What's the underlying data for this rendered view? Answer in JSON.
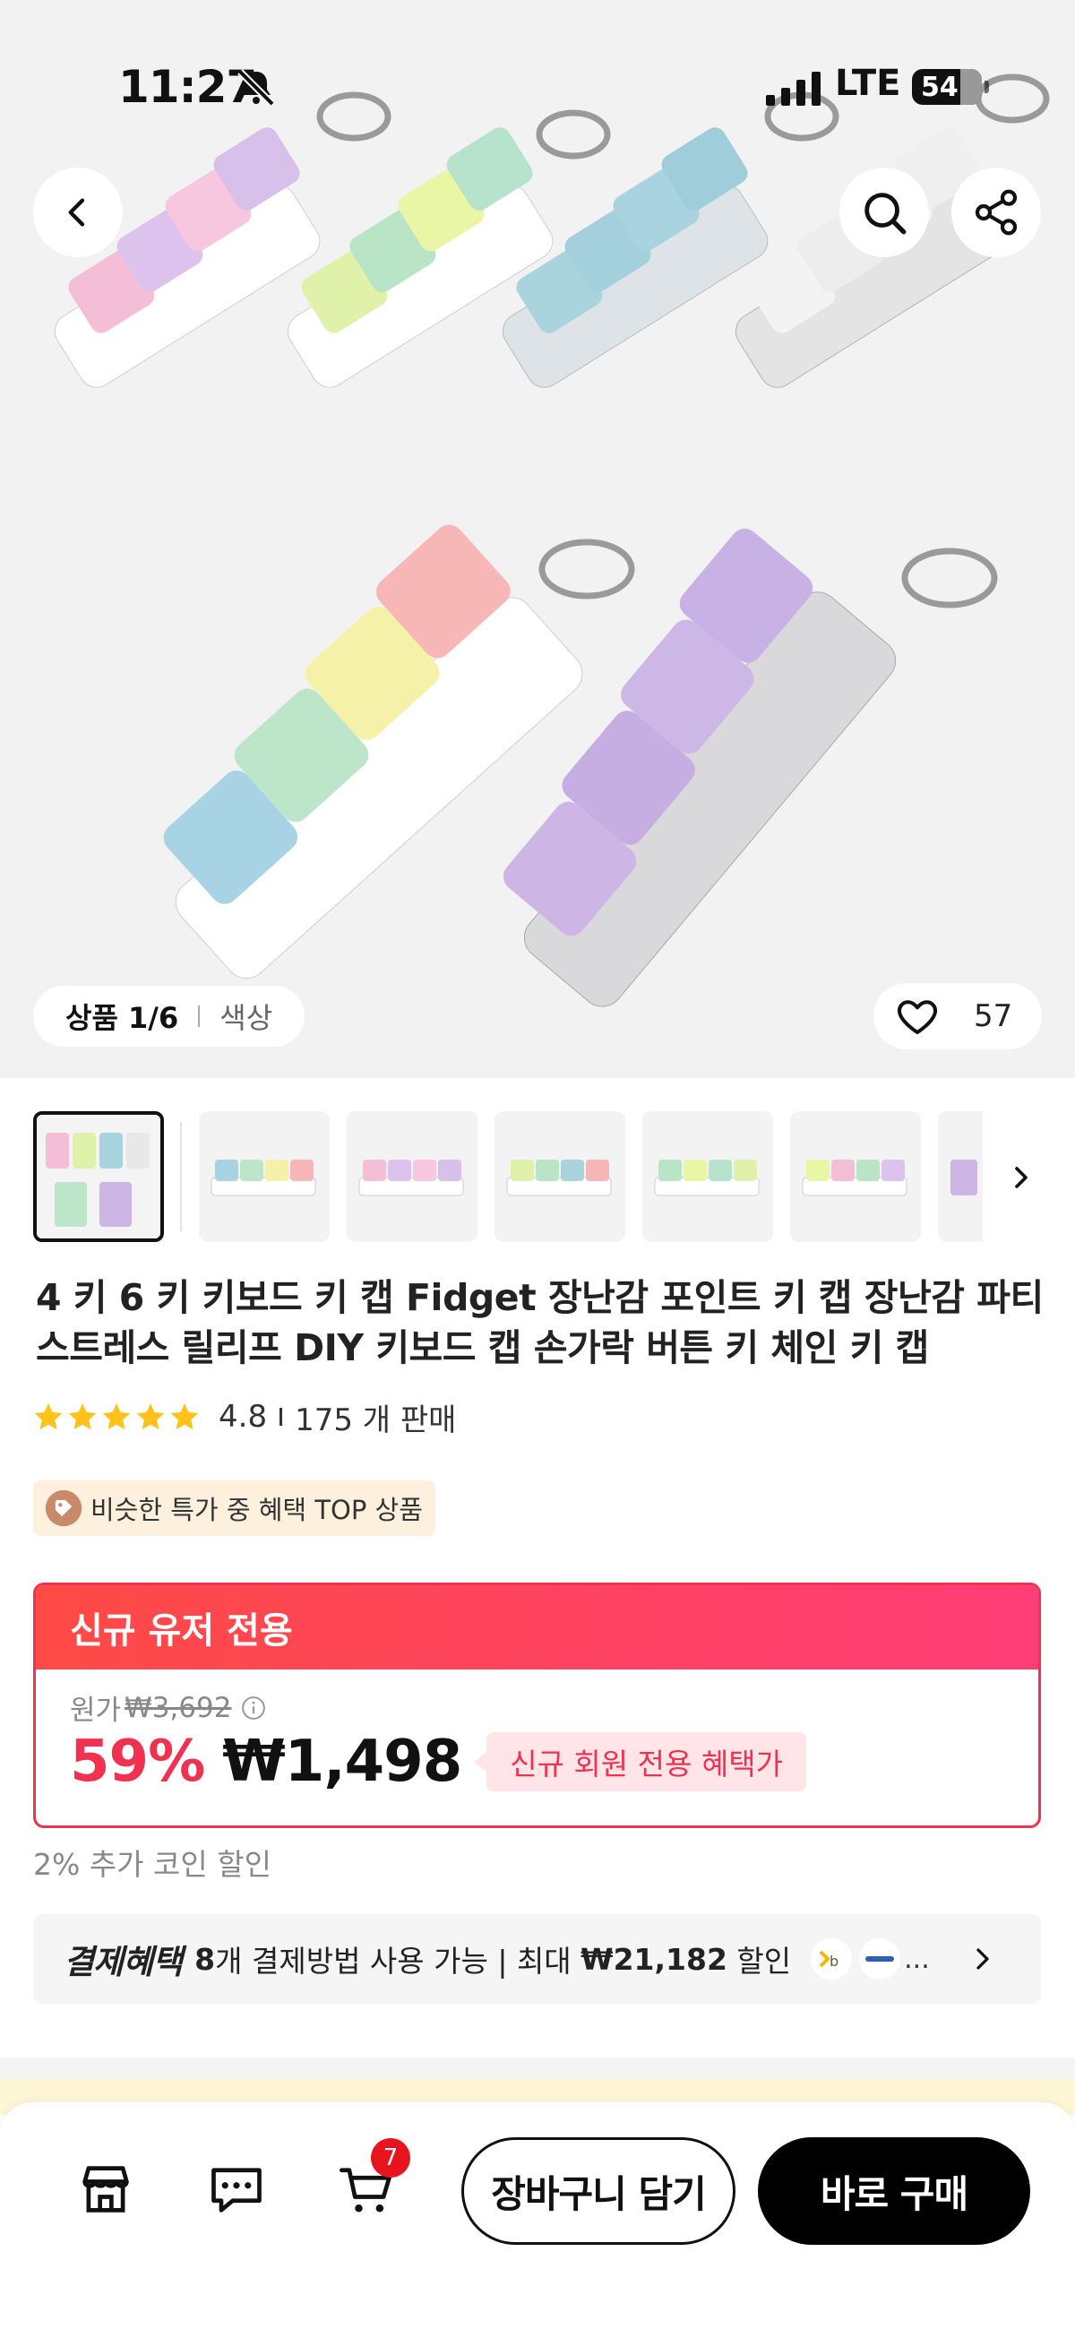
{
  "status_bar": {
    "time": "11:27",
    "network": "LTE",
    "battery": "54"
  },
  "hero": {
    "gallery_label": "상품 1/6",
    "color_label": "색상",
    "like_count": "57"
  },
  "product": {
    "title": "4 키 6 키 키보드 키 캡 Fidget 장난감 포인트 키 캡 장난감 파티 스트레스 릴리프 DIY 키보드 캡 손가락 버튼 키 체인 키 캡",
    "rating": "4.8",
    "sold": "175 개 판매",
    "promo_badge": "비슷한 특가 중 혜택 TOP 상품"
  },
  "new_user": {
    "header": "신규 유저 전용",
    "original_label": "원가",
    "original_price": "₩3,692",
    "discount": "59%",
    "price": "₩1,498",
    "badge": "신규 회원 전용 혜택가"
  },
  "coin_note": "2% 추가 코인 할인",
  "payment": {
    "title": "결제혜택",
    "count": "8",
    "text1": "개 결제방법 사용 가능 | 최대 ",
    "max": "₩21,182",
    "text2": " 할인",
    "more": "..."
  },
  "bottom_bar": {
    "cart_count": "7",
    "add_to_cart": "장바구니 담기",
    "buy_now": "바로 구매"
  },
  "colors": {
    "accent": "#f0314f",
    "star": "#ffc21a",
    "buy": "#000000"
  }
}
